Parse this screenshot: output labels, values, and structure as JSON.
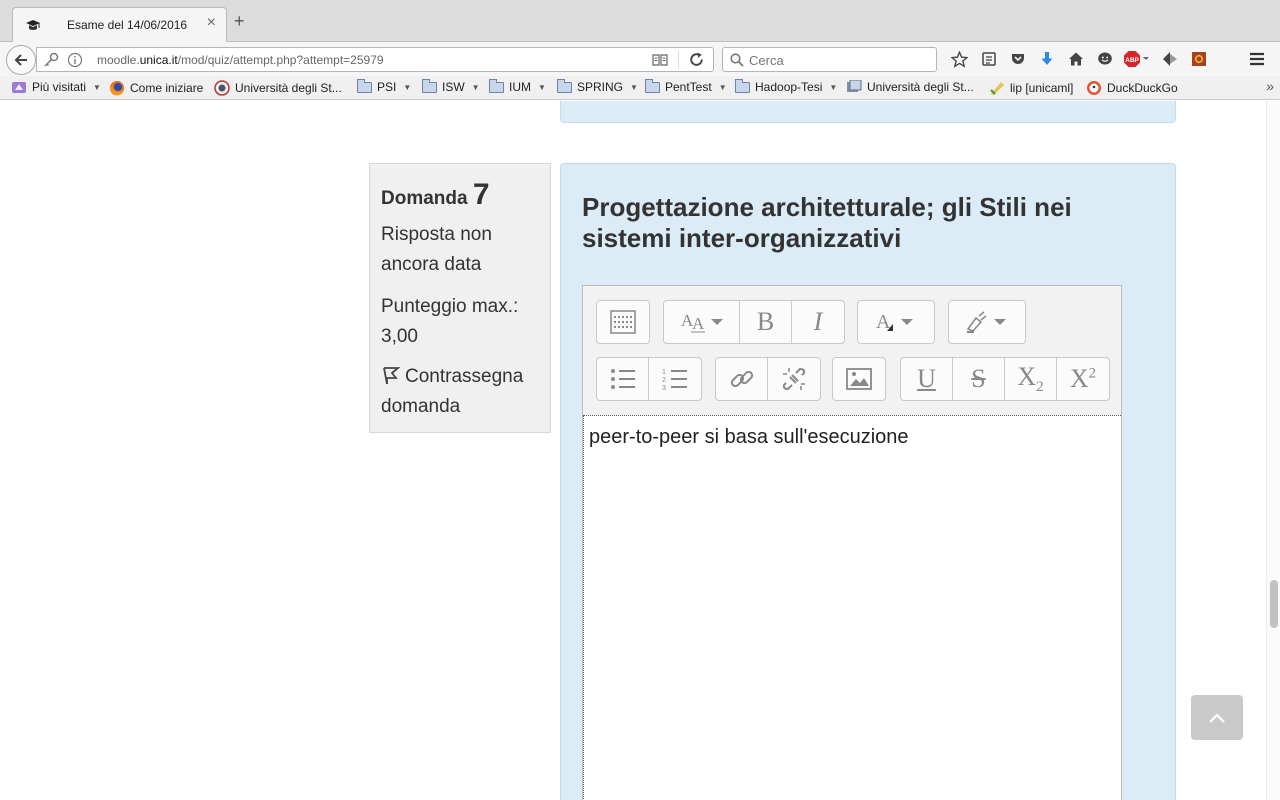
{
  "browser": {
    "tab_title": "Esame del 14/06/2016",
    "tab_close": "×",
    "new_tab": "+",
    "url_host_prefix": "moodle.",
    "url_host_domain": "unica.it",
    "url_path": "/mod/quiz/attempt.php?attempt=25979",
    "search_placeholder": "Cerca",
    "abp_label": "ABP"
  },
  "bookmarks": {
    "items": [
      {
        "label": "Più visitati",
        "type": "smart"
      },
      {
        "label": "Come iniziare",
        "type": "firefox"
      },
      {
        "label": "Università degli St...",
        "type": "site"
      },
      {
        "label": "PSI",
        "type": "folder"
      },
      {
        "label": "ISW",
        "type": "folder"
      },
      {
        "label": "IUM",
        "type": "folder"
      },
      {
        "label": "SPRING",
        "type": "folder"
      },
      {
        "label": "PentTest",
        "type": "folder"
      },
      {
        "label": "Hadoop-Tesi",
        "type": "folder"
      },
      {
        "label": "Università degli St...",
        "type": "site"
      },
      {
        "label": "lip [unicaml]",
        "type": "site"
      },
      {
        "label": "DuckDuckGo",
        "type": "site"
      }
    ],
    "overflow": "»"
  },
  "question": {
    "label": "Domanda",
    "number": "7",
    "status": "Risposta non ancora data",
    "max_score": "Punteggio max.: 3,00",
    "flag_label": "Contrassegna domanda",
    "title": "Progettazione architetturale; gli Stili nei sistemi inter-organizzativi"
  },
  "editor": {
    "content": "peer-to-peer si basa sull'esecuzione",
    "row1": [
      "toolbar-toggle",
      "font-size",
      "bold",
      "italic",
      "font-color",
      "background-color"
    ],
    "row2": [
      "unordered-list",
      "ordered-list",
      "link",
      "unlink",
      "image",
      "underline",
      "strikethrough",
      "subscript",
      "superscript"
    ],
    "bold_glyph": "B",
    "italic_glyph": "I",
    "underline_glyph": "U",
    "strike_glyph": "S",
    "sub_glyph": "X",
    "sub_index": "2",
    "sup_glyph": "X",
    "sup_index": "2"
  }
}
